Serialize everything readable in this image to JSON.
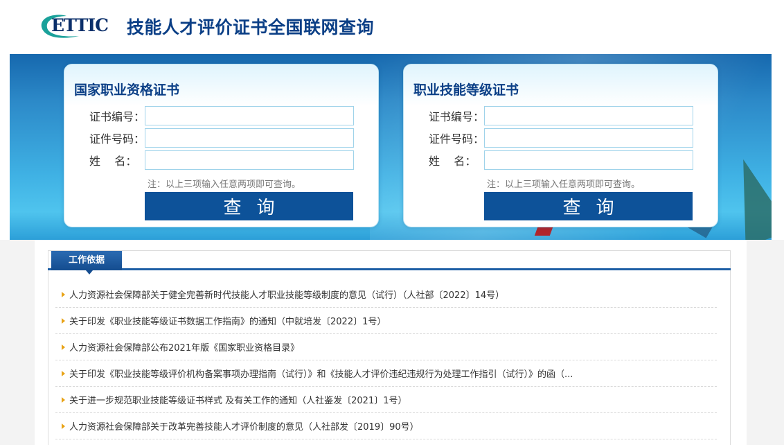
{
  "header": {
    "logo_text": "ETTIC",
    "title": "技能人才评价证书全国联网查询"
  },
  "panels": [
    {
      "title": "国家职业资格证书",
      "fields": [
        {
          "label": "证书编号：",
          "value": ""
        },
        {
          "label": "证件号码：",
          "value": ""
        },
        {
          "label": "姓    名：",
          "value": ""
        }
      ],
      "note": "注：以上三项输入任意两项即可查询。",
      "button": "查询"
    },
    {
      "title": "职业技能等级证书",
      "fields": [
        {
          "label": "证书编号：",
          "value": ""
        },
        {
          "label": "证件号码：",
          "value": ""
        },
        {
          "label": "姓    名：",
          "value": ""
        }
      ],
      "note": "注：以上三项输入任意两项即可查询。",
      "button": "查询"
    }
  ],
  "section": {
    "tab": "工作依据",
    "items": [
      "人力资源社会保障部关于健全完善新时代技能人才职业技能等级制度的意见（试行）（人社部〔2022〕14号）",
      "关于印发《职业技能等级证书数据工作指南》的通知（中就培发〔2022〕1号）",
      "人力资源社会保障部公布2021年版《国家职业资格目录》",
      "关于印发《职业技能等级评价机构备案事项办理指南（试行）》和《技能人才评价违纪违规行为处理工作指引（试行）》的函（...",
      "关于进一步规范职业技能等级证书样式 及有关工作的通知（人社鉴发〔2021〕1号）",
      "人力资源社会保障部关于改革完善技能人才评价制度的意见（人社部发〔2019〕90号）"
    ]
  },
  "colors": {
    "brand": "#0b3f86",
    "button": "#0d5299",
    "logo_teal": "#1aa19a",
    "bullet": "#e8a317"
  }
}
